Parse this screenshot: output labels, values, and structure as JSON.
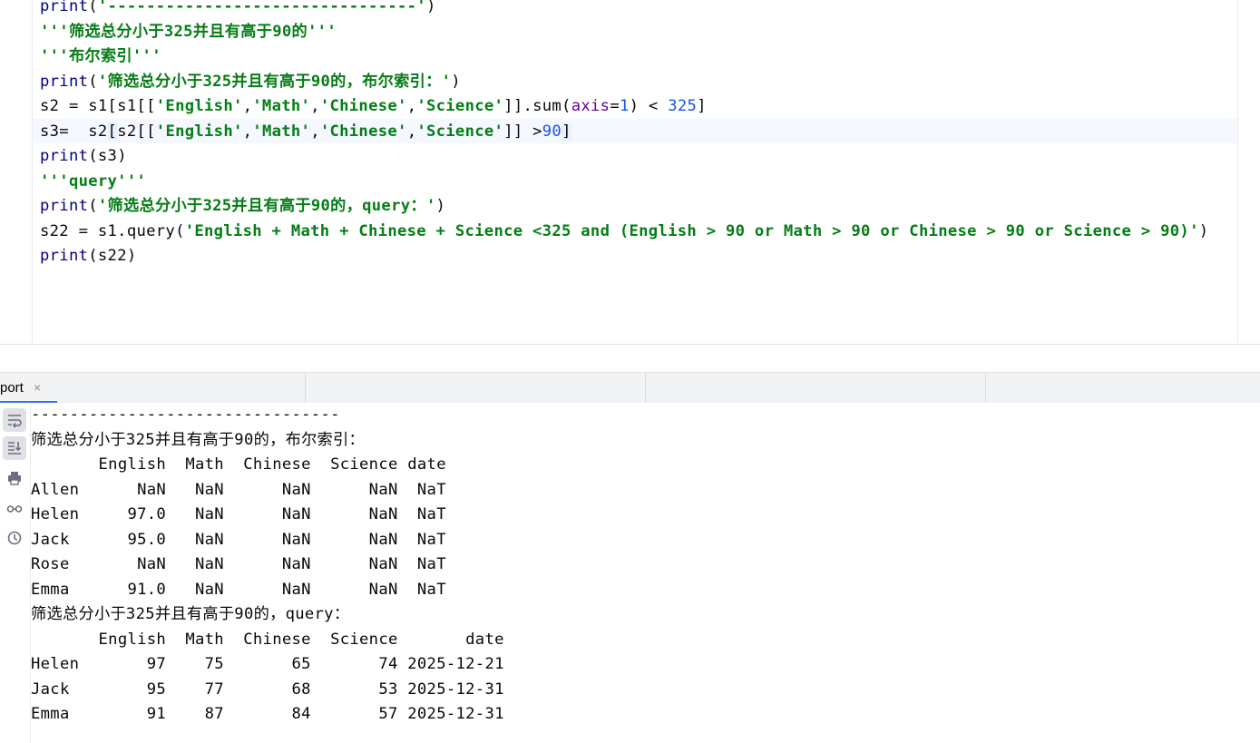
{
  "editor": {
    "lines": [
      {
        "parts": [
          {
            "t": "print",
            "c": "kw"
          },
          {
            "t": "(",
            "c": ""
          },
          {
            "t": "'--------------------------------'",
            "c": "str"
          },
          {
            "t": ")",
            "c": ""
          }
        ]
      },
      {
        "parts": [
          {
            "t": "'''筛选总分小于325并且有高于90的'''",
            "c": "str"
          }
        ]
      },
      {
        "parts": [
          {
            "t": "'''布尔索引'''",
            "c": "str"
          }
        ]
      },
      {
        "parts": [
          {
            "t": "print",
            "c": "kw"
          },
          {
            "t": "(",
            "c": ""
          },
          {
            "t": "'筛选总分小于325并且有高于90的，布尔索引：'",
            "c": "str"
          },
          {
            "t": ")",
            "c": ""
          }
        ]
      },
      {
        "parts": [
          {
            "t": "s2 = s1[s1[[",
            "c": ""
          },
          {
            "t": "'English'",
            "c": "str"
          },
          {
            "t": ",",
            "c": ""
          },
          {
            "t": "'Math'",
            "c": "str"
          },
          {
            "t": ",",
            "c": ""
          },
          {
            "t": "'Chinese'",
            "c": "str"
          },
          {
            "t": ",",
            "c": ""
          },
          {
            "t": "'Science'",
            "c": "str"
          },
          {
            "t": "]].sum(",
            "c": ""
          },
          {
            "t": "axis",
            "c": "param"
          },
          {
            "t": "=",
            "c": ""
          },
          {
            "t": "1",
            "c": "num"
          },
          {
            "t": ") < ",
            "c": ""
          },
          {
            "t": "325",
            "c": "num"
          },
          {
            "t": "]",
            "c": ""
          }
        ]
      },
      {
        "parts": [
          {
            "t": "s3=  s2",
            "c": ""
          },
          {
            "t": "[",
            "c": "caret"
          },
          {
            "t": "s2[[",
            "c": ""
          },
          {
            "t": "'English'",
            "c": "str"
          },
          {
            "t": ",",
            "c": ""
          },
          {
            "t": "'Math'",
            "c": "str"
          },
          {
            "t": ",",
            "c": ""
          },
          {
            "t": "'Chinese'",
            "c": "str"
          },
          {
            "t": ",",
            "c": ""
          },
          {
            "t": "'Science'",
            "c": "str"
          },
          {
            "t": "]] >",
            "c": ""
          },
          {
            "t": "90",
            "c": "num"
          },
          {
            "t": "]",
            "c": "caret"
          }
        ]
      },
      {
        "parts": [
          {
            "t": "print",
            "c": "kw"
          },
          {
            "t": "(s3)",
            "c": ""
          }
        ]
      },
      {
        "parts": [
          {
            "t": "'''query'''",
            "c": "str"
          }
        ]
      },
      {
        "parts": [
          {
            "t": "print",
            "c": "kw"
          },
          {
            "t": "(",
            "c": ""
          },
          {
            "t": "'筛选总分小于325并且有高于90的，query：'",
            "c": "str"
          },
          {
            "t": ")",
            "c": ""
          }
        ]
      },
      {
        "parts": [
          {
            "t": "s22 = s1.query(",
            "c": ""
          },
          {
            "t": "'English + Math + Chinese + Science <325 and (English > 90 or Math > 90 or Chinese > 90 or Science > 90)'",
            "c": "str"
          },
          {
            "t": ")",
            "c": ""
          }
        ]
      },
      {
        "parts": [
          {
            "t": "print",
            "c": "kw"
          },
          {
            "t": "(s22)",
            "c": ""
          }
        ]
      }
    ]
  },
  "run_tab": {
    "label": "port",
    "close": "×"
  },
  "console": {
    "lines": [
      "--------------------------------",
      "筛选总分小于325并且有高于90的，布尔索引：",
      "       English  Math  Chinese  Science date",
      "Allen      NaN   NaN      NaN      NaN  NaT",
      "Helen     97.0   NaN      NaN      NaN  NaT",
      "Jack      95.0   NaN      NaN      NaN  NaT",
      "Rose       NaN   NaN      NaN      NaN  NaT",
      "Emma      91.0   NaN      NaN      NaN  NaT",
      "筛选总分小于325并且有高于90的，query：",
      "       English  Math  Chinese  Science       date",
      "Helen       97    75       65       74 2025-12-21",
      "Jack        95    77       68       53 2025-12-31",
      "Emma        91    87       84       57 2025-12-31"
    ],
    "tools": [
      {
        "icon": "soft-wrap-icon",
        "active": true
      },
      {
        "icon": "scroll-to-end-icon",
        "active": true
      },
      {
        "icon": "print-icon",
        "active": false
      },
      {
        "icon": "glasses-icon",
        "active": false
      },
      {
        "icon": "history-icon",
        "active": false
      }
    ]
  },
  "colors": {
    "keyword": "#000080",
    "string": "#067d17",
    "number": "#1750eb",
    "param": "#660099",
    "accent": "#3574f0"
  }
}
